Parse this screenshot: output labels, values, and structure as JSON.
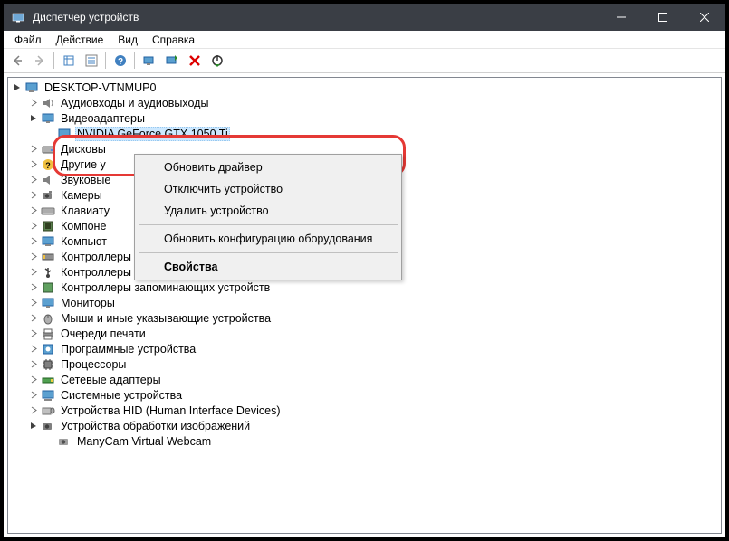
{
  "title": "Диспетчер устройств",
  "menu": {
    "file": "Файл",
    "action": "Действие",
    "view": "Вид",
    "help": "Справка"
  },
  "root": "DESKTOP-VTNMUP0",
  "categories": {
    "audio": "Аудиовходы и аудиовыходы",
    "video": "Видеоадаптеры",
    "gpu": "NVIDIA GeForce GTX 1050 Ti",
    "disk": "Дисковы",
    "other": "Другие у",
    "sound": "Звуковые",
    "cameras": "Камеры",
    "keyboards": "Клавиату",
    "components": "Компоне",
    "computer": "Компьют",
    "ide": "Контроллеры IDE ATA/ATAPI",
    "usb": "Контроллеры USB",
    "storage": "Контроллеры запоминающих устройств",
    "monitors": "Мониторы",
    "mice": "Мыши и иные указывающие устройства",
    "print": "Очереди печати",
    "software": "Программные устройства",
    "cpu": "Процессоры",
    "net": "Сетевые адаптеры",
    "system": "Системные устройства",
    "hid": "Устройства HID (Human Interface Devices)",
    "imaging": "Устройства обработки изображений",
    "webcam": "ManyCam Virtual Webcam"
  },
  "context": {
    "update": "Обновить драйвер",
    "disable": "Отключить устройство",
    "remove": "Удалить устройство",
    "refresh": "Обновить конфигурацию оборудования",
    "props": "Свойства"
  }
}
